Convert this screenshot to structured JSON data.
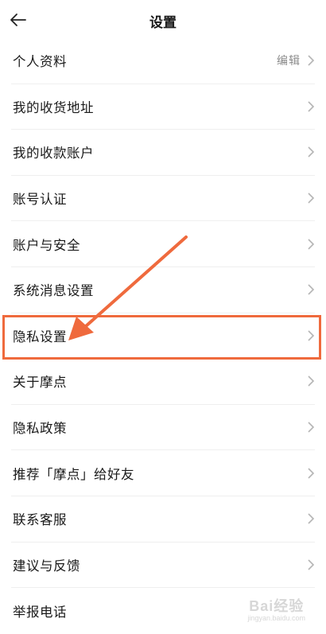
{
  "header": {
    "title": "设置",
    "back_icon": "arrow-left-icon"
  },
  "settings": {
    "items": [
      {
        "label": "个人资料",
        "value": "编辑"
      },
      {
        "label": "我的收货地址",
        "value": ""
      },
      {
        "label": "我的收款账户",
        "value": ""
      },
      {
        "label": "账号认证",
        "value": ""
      },
      {
        "label": "账户与安全",
        "value": ""
      },
      {
        "label": "系统消息设置",
        "value": ""
      },
      {
        "label": "隐私设置",
        "value": ""
      },
      {
        "label": "关于摩点",
        "value": ""
      },
      {
        "label": "隐私政策",
        "value": ""
      },
      {
        "label": "推荐「摩点」给好友",
        "value": ""
      },
      {
        "label": "联系客服",
        "value": ""
      },
      {
        "label": "建议与反馈",
        "value": ""
      },
      {
        "label": "举报电话",
        "value": ""
      }
    ]
  },
  "annotation": {
    "color": "#ef6a3d"
  },
  "watermark": {
    "logo": "Bai经验",
    "url": "jingyan.baidu.com"
  }
}
